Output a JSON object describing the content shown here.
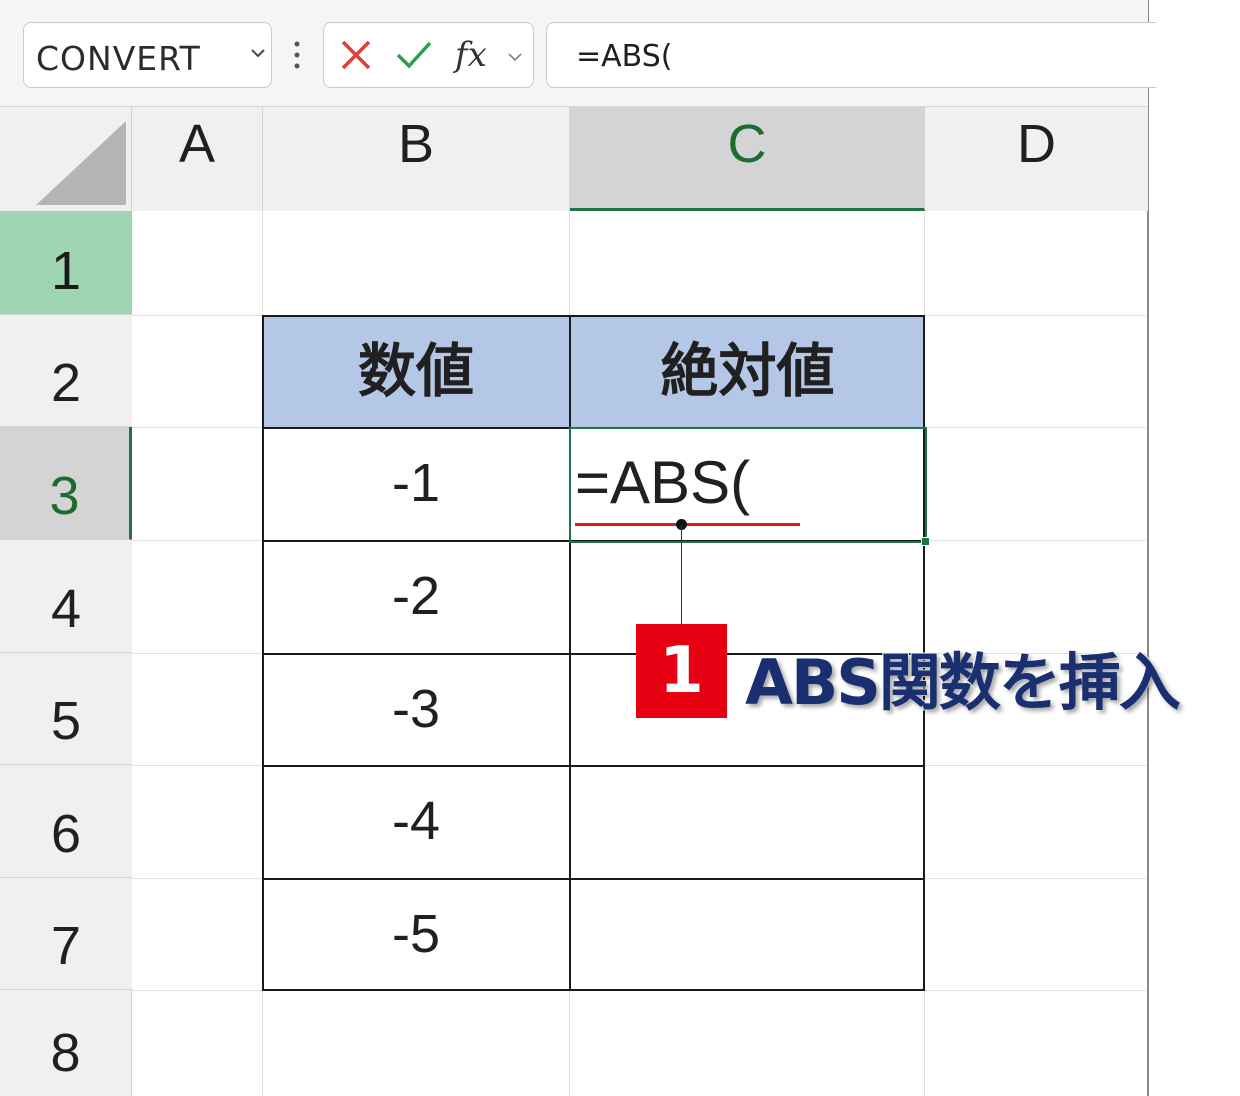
{
  "formula_bar": {
    "name_box": "CONVERT",
    "fx_label": "fx",
    "formula": "=ABS("
  },
  "columns": [
    "A",
    "B",
    "C",
    "D"
  ],
  "rows": [
    "1",
    "2",
    "3",
    "4",
    "5",
    "6",
    "7",
    "8"
  ],
  "table": {
    "headers": [
      "数値",
      "絶対値"
    ],
    "values": [
      "-1",
      "-2",
      "-3",
      "-4",
      "-5"
    ]
  },
  "active_cell": {
    "text": "=ABS("
  },
  "annotation": {
    "step": "1",
    "text": "ABS関数を挿入"
  },
  "colors": {
    "accent_green": "#217346",
    "header_blue": "#b4c7e7",
    "badge_red": "#e60012",
    "callout_navy": "#1a2f6f"
  }
}
